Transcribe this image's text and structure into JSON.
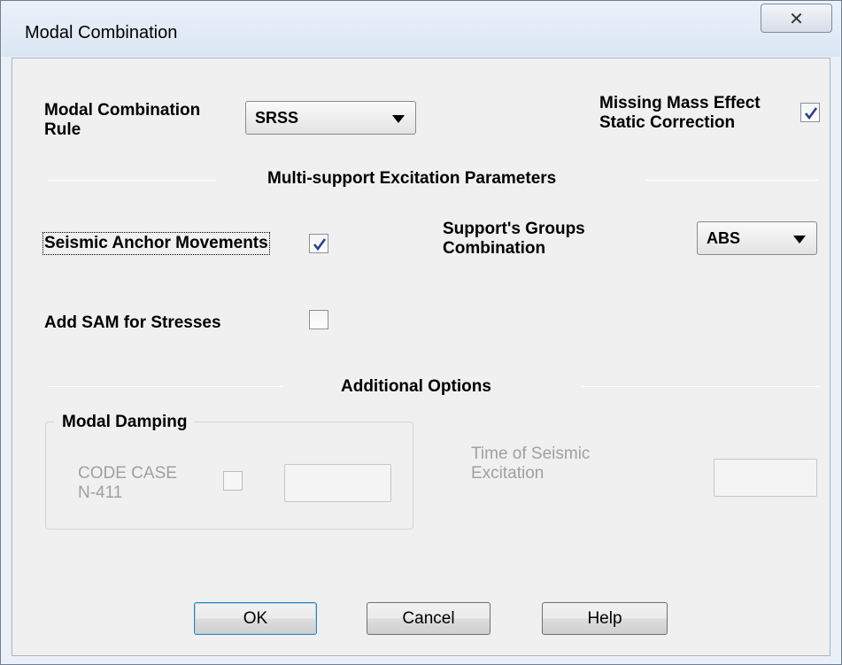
{
  "window": {
    "title": "Modal Combination",
    "close_icon": "close-icon",
    "close_glyph": "✕"
  },
  "modal_rule": {
    "label": "Modal Combination Rule",
    "selected": "SRSS"
  },
  "missing_mass": {
    "label_line1": "Missing Mass Effect",
    "label_line2": "Static Correction",
    "checked": true
  },
  "multi_support": {
    "section_title": "Multi-support Excitation Parameters",
    "seismic_anchor": {
      "label": "Seismic Anchor Movements",
      "checked": true
    },
    "support_groups": {
      "label_line1": "Support's Groups",
      "label_line2": "Combination",
      "selected": "ABS"
    },
    "add_sam": {
      "label": "Add SAM for Stresses",
      "checked": false
    }
  },
  "additional": {
    "section_title": "Additional Options",
    "modal_damping": {
      "group_title": "Modal Damping",
      "code_case_line1": "CODE CASE",
      "code_case_line2": "N-411",
      "checked": false,
      "value": ""
    },
    "time_excitation": {
      "label_line1": "Time of Seismic",
      "label_line2": "Excitation",
      "value": ""
    }
  },
  "buttons": {
    "ok": "OK",
    "cancel": "Cancel",
    "help": "Help"
  },
  "colors": {
    "titlebar": "#dbe6f3",
    "client": "#f0f0f0",
    "checkmark": "#2a3f8f"
  }
}
